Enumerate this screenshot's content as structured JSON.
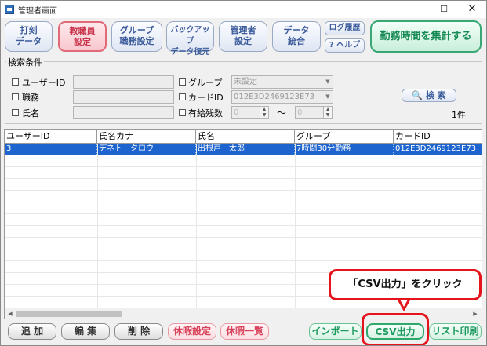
{
  "window": {
    "title": "管理者画面",
    "min_icon": "minimize-icon",
    "max_icon": "maximize-icon",
    "close_icon": "close-icon"
  },
  "toolbar": {
    "buttons": [
      {
        "label": "打刻\nデータ",
        "active": false
      },
      {
        "label": "教職員\n設定",
        "active": true
      },
      {
        "label": "グループ\n職務設定",
        "active": false
      },
      {
        "label": "バックアップ\nデータ復元",
        "active": false
      },
      {
        "label": "管理者\n設定",
        "active": false
      },
      {
        "label": "データ\n統合",
        "active": false
      }
    ],
    "log_label": "ログ履歴",
    "help_label": "? ヘルプ",
    "aggregate_label": "勤務時間を集計する"
  },
  "search": {
    "group_label": "検索条件",
    "user_id_label": "ユーザーID",
    "job_label": "職務",
    "name_label": "氏名",
    "group_field_label": "グループ",
    "group_value": "未設定",
    "card_label": "カードID",
    "card_value": "012E3D2469123E73",
    "leave_label": "有給残数",
    "leave_from": "0",
    "leave_to": "0",
    "range_sep": "～",
    "search_button": "検 索",
    "search_icon": "search-icon",
    "count": "1件"
  },
  "table": {
    "columns": [
      "ユーザーID",
      "氏名カナ",
      "氏名",
      "グループ",
      "カードID"
    ],
    "rows": [
      [
        "3",
        "デネト　タロウ",
        "出根戸　太郎",
        "7時間30分勤務",
        "012E3D2469123E73"
      ]
    ]
  },
  "bottom": {
    "add": "追 加",
    "edit": "編 集",
    "delete": "削 除",
    "leave_setting": "休暇設定",
    "leave_list": "休暇一覧",
    "import": "インポート",
    "csv": "CSV出力",
    "print": "リスト印刷"
  },
  "annotation": {
    "callout_text": "「CSV出力」をクリック"
  },
  "colors": {
    "accent_red": "#e5131c",
    "selection_blue": "#1e64cf",
    "aggregate_green": "#178a55"
  }
}
